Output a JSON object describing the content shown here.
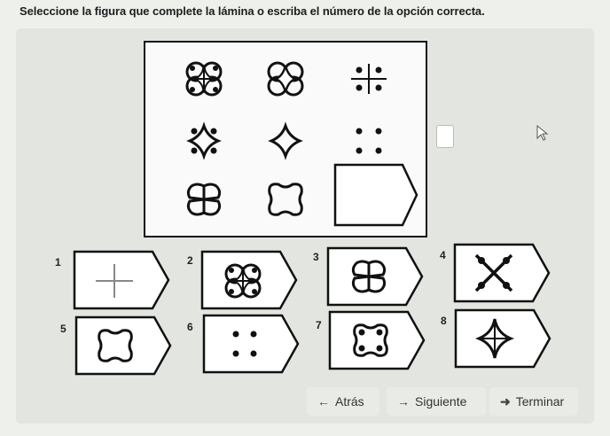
{
  "instruction": "Seleccione la figura que complete la lámina o escriba el número de la opción correcta.",
  "answer": {
    "value": ""
  },
  "options": [
    {
      "number": "1"
    },
    {
      "number": "2"
    },
    {
      "number": "3"
    },
    {
      "number": "4"
    },
    {
      "number": "5"
    },
    {
      "number": "6"
    },
    {
      "number": "7"
    },
    {
      "number": "8"
    }
  ],
  "nav": {
    "back_label": "Atrás",
    "next_label": "Siguiente",
    "finish_label": "Terminar"
  }
}
